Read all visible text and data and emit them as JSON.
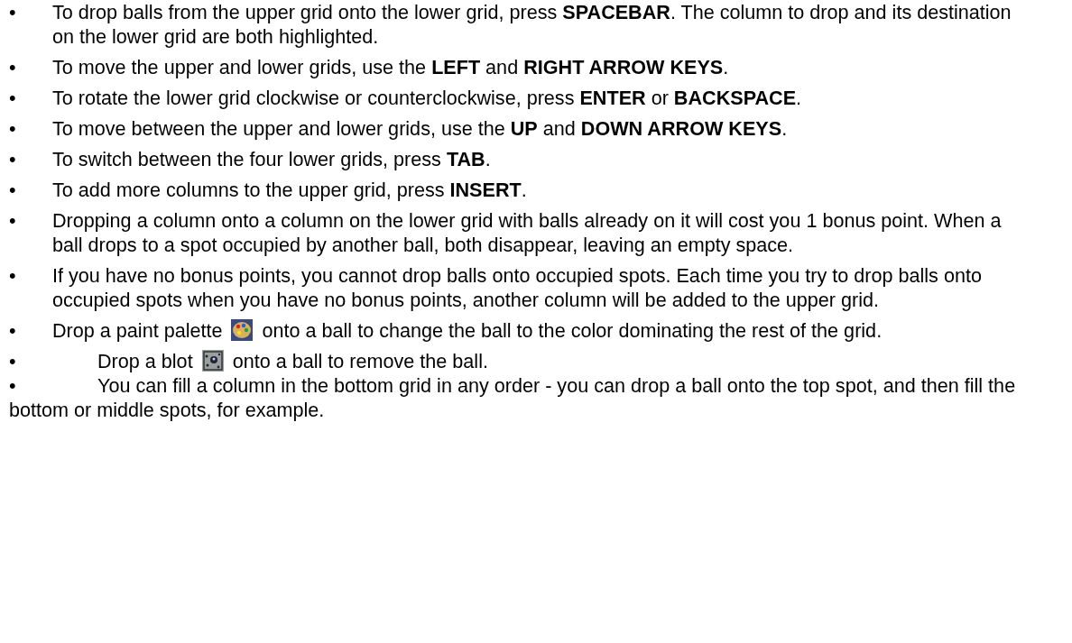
{
  "items": [
    {
      "kind": "hanging",
      "bullet": "•",
      "parts": [
        {
          "kind": "text",
          "text": "To drop balls from the upper grid onto the lower grid, press **SPACEBAR**. The column to drop and its destination on the lower grid are both highlighted."
        }
      ]
    },
    {
      "kind": "hanging",
      "bullet": "•",
      "parts": [
        {
          "kind": "text",
          "text": "To move the upper and lower grids, use the **LEFT** and **RIGHT ARROW KEYS**."
        }
      ]
    },
    {
      "kind": "hanging",
      "bullet": "•",
      "parts": [
        {
          "kind": "text",
          "text": "To rotate the lower grid clockwise or counterclockwise, press **ENTER** or **BACKSPACE**."
        }
      ]
    },
    {
      "kind": "hanging",
      "bullet": "•",
      "parts": [
        {
          "kind": "text",
          "text": "To move between the upper and lower grids, use the **UP** and **DOWN ARROW KEYS**."
        }
      ]
    },
    {
      "kind": "hanging",
      "bullet": "•",
      "parts": [
        {
          "kind": "text",
          "text": "To switch between the four lower grids, press **TAB**."
        }
      ]
    },
    {
      "kind": "hanging",
      "bullet": "•",
      "parts": [
        {
          "kind": "text",
          "text": "To add more columns to the upper grid, press **INSERT**."
        }
      ]
    },
    {
      "kind": "hanging",
      "bullet": "•",
      "parts": [
        {
          "kind": "text",
          "text": "Dropping a column onto a column on the lower grid with balls already on it will cost you 1 bonus point. When a ball drops to a spot occupied by another ball, both disappear, leaving an empty space."
        }
      ]
    },
    {
      "kind": "hanging",
      "bullet": "•",
      "parts": [
        {
          "kind": "text",
          "text": "If you have no bonus points, you cannot drop balls onto occupied spots. Each time you try to drop balls onto occupied spots when you have no bonus points, another column will be added to the upper grid."
        }
      ]
    },
    {
      "kind": "hanging",
      "bullet": "•",
      "parts": [
        {
          "kind": "text",
          "text": "Drop a paint palette"
        },
        {
          "kind": "palette"
        },
        {
          "kind": "text",
          "text": "onto a ball to change the ball to the color dominating the rest of the grid."
        }
      ]
    },
    {
      "kind": "inline",
      "bullet": "•",
      "parts": [
        {
          "kind": "text",
          "text": "Drop a blot"
        },
        {
          "kind": "blot"
        },
        {
          "kind": "text",
          "text": "onto a ball to remove the ball."
        }
      ]
    },
    {
      "kind": "inline",
      "bullet": "•",
      "parts": [
        {
          "kind": "text",
          "text": "You can fill a column in the bottom grid in any order - you can drop a ball onto the top spot, and then fill the bottom or middle spots, for example."
        }
      ]
    }
  ]
}
